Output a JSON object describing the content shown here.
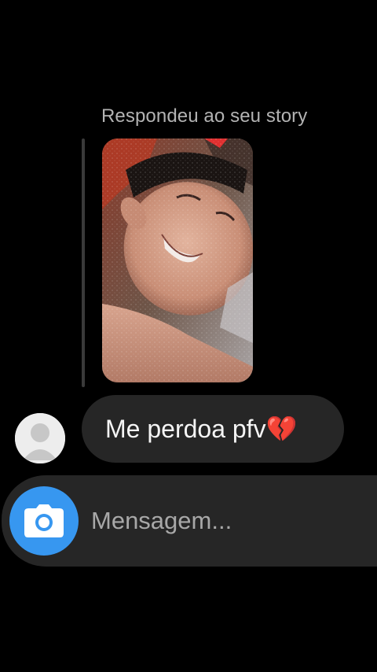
{
  "story_reply": {
    "caption": "Respondeu ao seu story",
    "thumbnail": "story-photo"
  },
  "message": {
    "text": "Me perdoa pfv",
    "emoji": "💔",
    "sender_avatar": "default-avatar-icon"
  },
  "composer": {
    "placeholder": "Mensagem...",
    "value": "",
    "camera_icon": "camera-icon"
  },
  "colors": {
    "background": "#000000",
    "bubble": "#262626",
    "accent": "#3797f0",
    "caption": "#b3b3b3"
  }
}
